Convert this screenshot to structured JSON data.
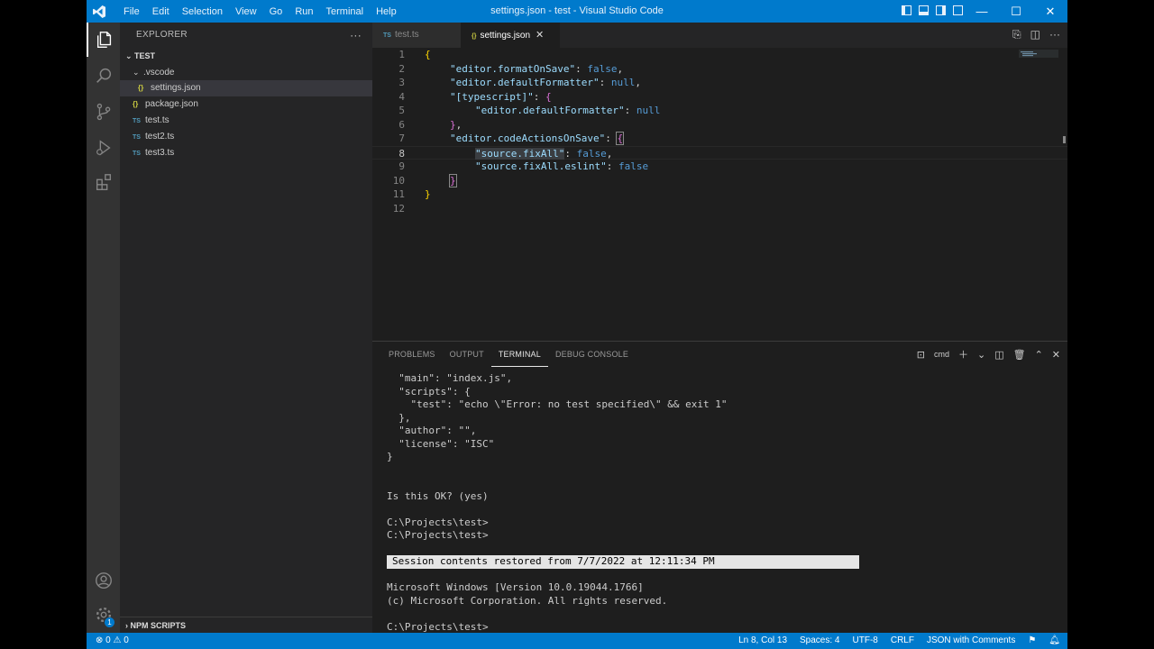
{
  "titlebar": {
    "menu": [
      "File",
      "Edit",
      "Selection",
      "View",
      "Go",
      "Run",
      "Terminal",
      "Help"
    ],
    "title": "settings.json - test - Visual Studio Code",
    "controls": {
      "minimize": "—",
      "maximize": "☐",
      "close": "✕"
    }
  },
  "explorer": {
    "header": "EXPLORER",
    "more": "···",
    "folder": "TEST",
    "items": [
      {
        "label": ".vscode",
        "type": "folder",
        "indent": 1
      },
      {
        "label": "settings.json",
        "type": "json",
        "indent": 2,
        "selected": true
      },
      {
        "label": "package.json",
        "type": "json",
        "indent": 1
      },
      {
        "label": "test.ts",
        "type": "ts",
        "indent": 1
      },
      {
        "label": "test2.ts",
        "type": "ts",
        "indent": 1
      },
      {
        "label": "test3.ts",
        "type": "ts",
        "indent": 1
      }
    ],
    "npm_scripts": "NPM SCRIPTS",
    "json_icon": "{}",
    "ts_icon": "TS"
  },
  "tabs": [
    {
      "label": "test.ts",
      "icon": "TS",
      "active": false
    },
    {
      "label": "settings.json",
      "icon": "{}",
      "active": true,
      "close": "✕"
    }
  ],
  "editor": {
    "lines": [
      "1",
      "2",
      "3",
      "4",
      "5",
      "6",
      "7",
      "8",
      "9",
      "10",
      "11",
      "12"
    ],
    "current_line": 8,
    "code": {
      "l1_brace": "{",
      "l2_key": "\"editor.formatOnSave\"",
      "l2_val": "false",
      "l3_key": "\"editor.defaultFormatter\"",
      "l3_val": "null",
      "l4_key": "\"[typescript]\"",
      "l4_open": "{",
      "l5_key": "\"editor.defaultFormatter\"",
      "l5_val": "null",
      "l6_close": "}",
      "l7_key": "\"editor.codeActionsOnSave\"",
      "l7_open": "{",
      "l8_key": "\"source.fixAll\"",
      "l8_val": "false",
      "l9_key": "\"source.fixAll.eslint\"",
      "l9_val": "false",
      "l10_close": "}",
      "l11_close": "}",
      "colon": ": ",
      "comma": ","
    }
  },
  "panel": {
    "tabs": [
      "PROBLEMS",
      "OUTPUT",
      "TERMINAL",
      "DEBUG CONSOLE"
    ],
    "active_tab": "TERMINAL",
    "shell": "cmd",
    "terminal_lines": [
      "  \"main\": \"index.js\",",
      "  \"scripts\": {",
      "    \"test\": \"echo \\\"Error: no test specified\\\" && exit 1\"",
      "  },",
      "  \"author\": \"\",",
      "  \"license\": \"ISC\"",
      "}",
      "",
      "",
      "Is this OK? (yes)",
      "",
      "C:\\Projects\\test>",
      "C:\\Projects\\test>",
      "",
      "Session contents restored from 7/7/2022 at 12:11:34 PM",
      "",
      "Microsoft Windows [Version 10.0.19044.1766]",
      "(c) Microsoft Corporation. All rights reserved.",
      "",
      "C:\\Projects\\test>"
    ]
  },
  "statusbar": {
    "problems": "⊗ 0 ⚠ 0",
    "position": "Ln 8, Col 13",
    "spaces": "Spaces: 4",
    "encoding": "UTF-8",
    "eol": "CRLF",
    "language": "JSON with Comments",
    "bell": "🔔︎"
  },
  "colors": {
    "accent": "#007acc",
    "activity_bar": "#333333",
    "sidebar": "#252526",
    "editor": "#1e1e1e"
  }
}
